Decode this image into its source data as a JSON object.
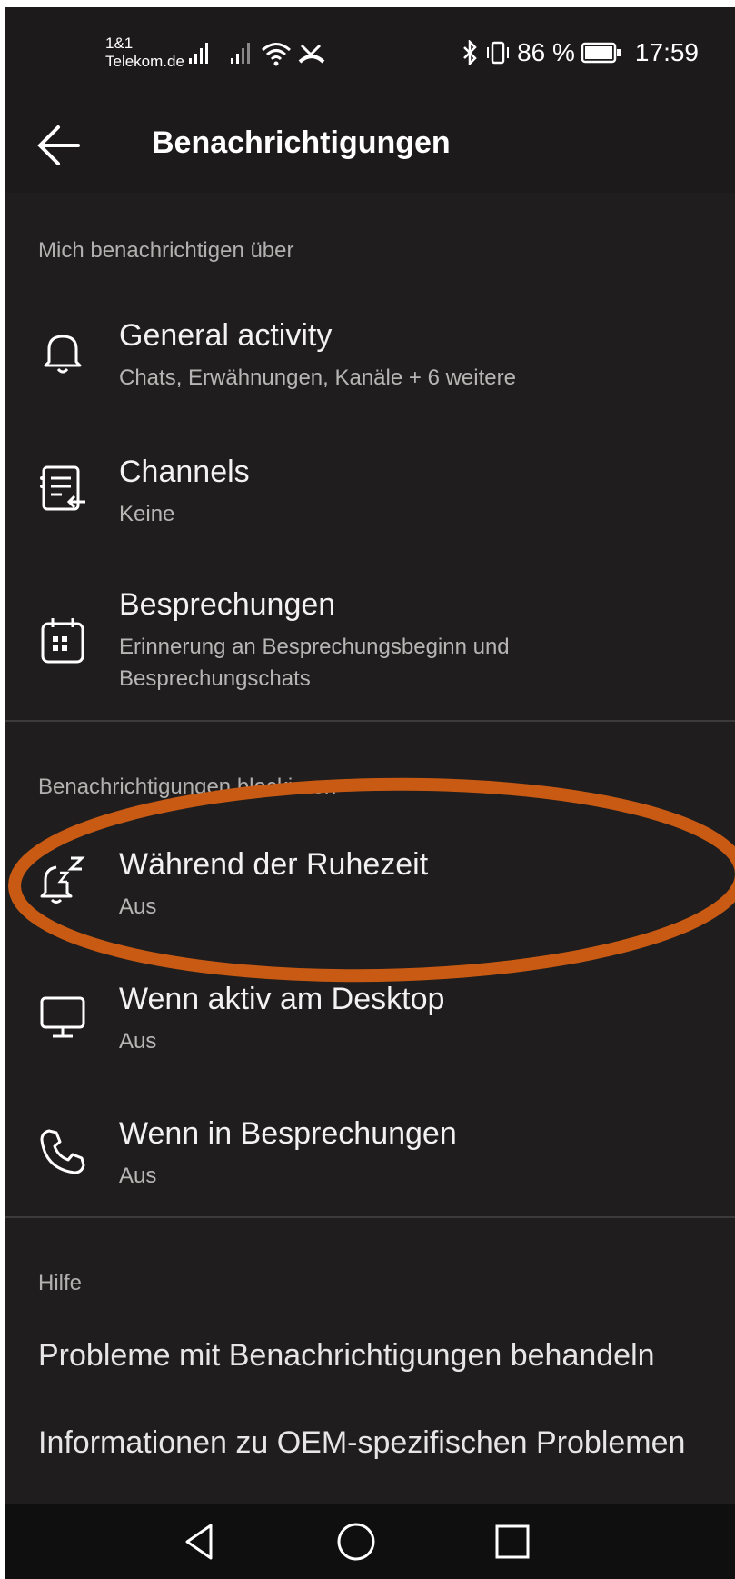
{
  "status_bar": {
    "carrier_line1": "1&1",
    "carrier_line2": "Telekom.de",
    "battery_percent": "86 %",
    "time": "17:59"
  },
  "header": {
    "title": "Benachrichtigungen"
  },
  "sections": {
    "notify_about": {
      "label": "Mich benachrichtigen über",
      "items": [
        {
          "title": "General activity",
          "subtitle": "Chats, Erwähnungen, Kanäle +  6 weitere",
          "icon": "bell-icon"
        },
        {
          "title": "Channels",
          "subtitle": "Keine",
          "icon": "channels-icon"
        },
        {
          "title": "Besprechungen",
          "subtitle_line1": "Erinnerung an Besprechungsbeginn und",
          "subtitle_line2": "Besprechungschats",
          "icon": "calendar-icon"
        }
      ]
    },
    "block": {
      "label": "Benachrichtigungen blockieren",
      "items": [
        {
          "title": "Während der Ruhezeit",
          "subtitle": "Aus",
          "icon": "quiet-bell-icon"
        },
        {
          "title": "Wenn aktiv am Desktop",
          "subtitle": "Aus",
          "icon": "desktop-icon"
        },
        {
          "title": "Wenn in Besprechungen",
          "subtitle": "Aus",
          "icon": "phone-icon"
        }
      ]
    },
    "help": {
      "label": "Hilfe",
      "links": [
        "Probleme mit Benachrichtigungen behandeln",
        "Informationen zu OEM-spezifischen Problemen"
      ]
    }
  },
  "colors": {
    "background": "#1f1d1d",
    "annotation": "#c85a14"
  }
}
